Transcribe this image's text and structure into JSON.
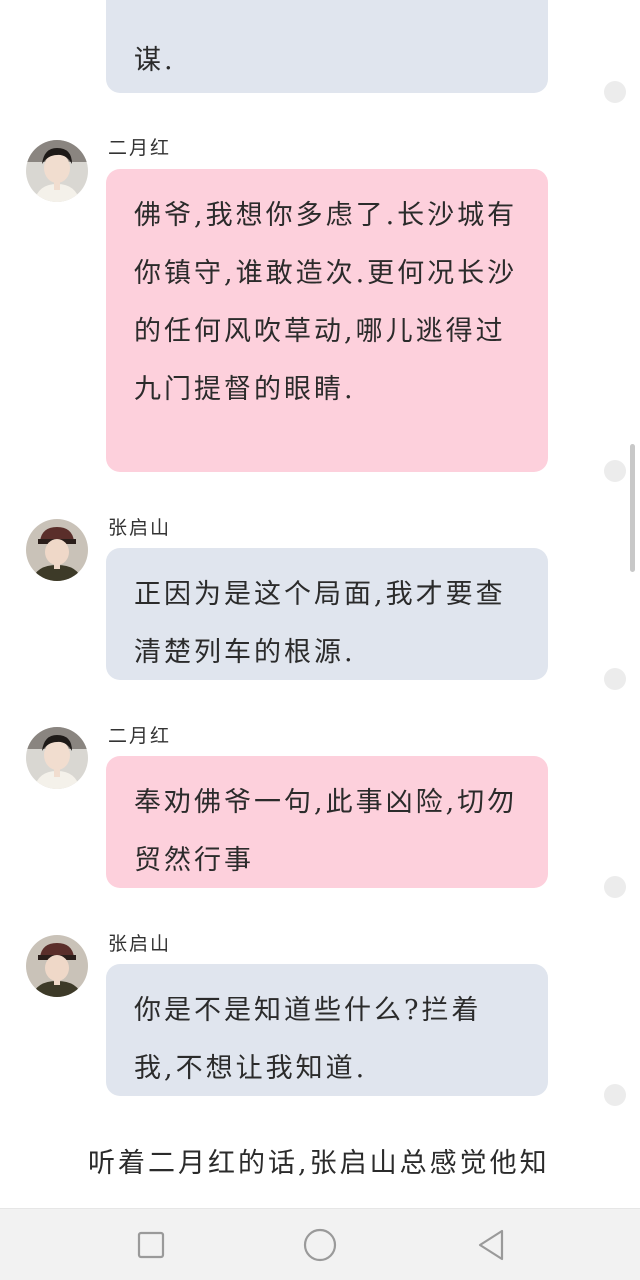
{
  "messages": [
    {
      "speaker": "",
      "text": "谋.",
      "style": "blue",
      "avatar": ""
    },
    {
      "speaker": "二月红",
      "text": "佛爷,我想你多虑了.长沙城有你镇守,谁敢造次.更何况长沙的任何风吹草动,哪儿逃得过九门提督的眼睛.",
      "style": "pink",
      "avatar": "er-yue-hong-avatar"
    },
    {
      "speaker": "张启山",
      "text": "正因为是这个局面,我才要查清楚列车的根源.",
      "style": "blue",
      "avatar": "zhang-qi-shan-avatar"
    },
    {
      "speaker": "二月红",
      "text": "奉劝佛爷一句,此事凶险,切勿贸然行事",
      "style": "pink",
      "avatar": "er-yue-hong-avatar"
    },
    {
      "speaker": "张启山",
      "text": "你是不是知道些什么?拦着我,不想让我知道.",
      "style": "blue",
      "avatar": "zhang-qi-shan-avatar"
    }
  ],
  "narration": "听着二月红的话,张启山总感觉他知",
  "colors": {
    "bubble_blue": "#e0e5ee",
    "bubble_pink": "#fdd0dc",
    "navbar_bg": "#f2f2f2"
  },
  "navbar": {
    "icons": [
      "recent-apps-icon",
      "home-icon",
      "back-icon"
    ]
  }
}
